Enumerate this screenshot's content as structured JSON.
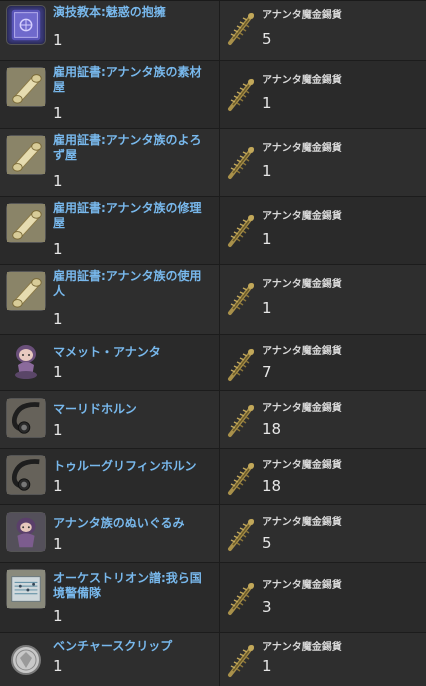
{
  "currency": {
    "name": "アナンタ魔金錫貨",
    "icon": "ananta-coin-icon"
  },
  "items": [
    {
      "name": "演技教本:魅惑の抱擁",
      "qty": "1",
      "icon": "book-icon",
      "cost": "5"
    },
    {
      "name": "雇用証書:アナンタ族の素材屋",
      "qty": "1",
      "icon": "scroll-icon",
      "cost": "1"
    },
    {
      "name": "雇用証書:アナンタ族のよろず屋",
      "qty": "1",
      "icon": "scroll-icon",
      "cost": "1"
    },
    {
      "name": "雇用証書:アナンタ族の修理屋",
      "qty": "1",
      "icon": "scroll-icon",
      "cost": "1"
    },
    {
      "name": "雇用証書:アナンタ族の使用人",
      "qty": "1",
      "icon": "scroll-icon",
      "cost": "1"
    },
    {
      "name": "マメット・アナンタ",
      "qty": "1",
      "icon": "minion-icon",
      "cost": "7"
    },
    {
      "name": "マーリドホルン",
      "qty": "1",
      "icon": "horn-icon",
      "cost": "18"
    },
    {
      "name": "トゥルーグリフィンホルン",
      "qty": "1",
      "icon": "horn-icon",
      "cost": "18"
    },
    {
      "name": "アナンタ族のぬいぐるみ",
      "qty": "1",
      "icon": "plush-icon",
      "cost": "5"
    },
    {
      "name": "オーケストリオン譜:我ら国境警備隊",
      "qty": "1",
      "icon": "sheet-music-icon",
      "cost": "3"
    },
    {
      "name": "ベンチャースクリップ",
      "qty": "1",
      "icon": "venture-coin-icon",
      "cost": "1"
    }
  ]
}
